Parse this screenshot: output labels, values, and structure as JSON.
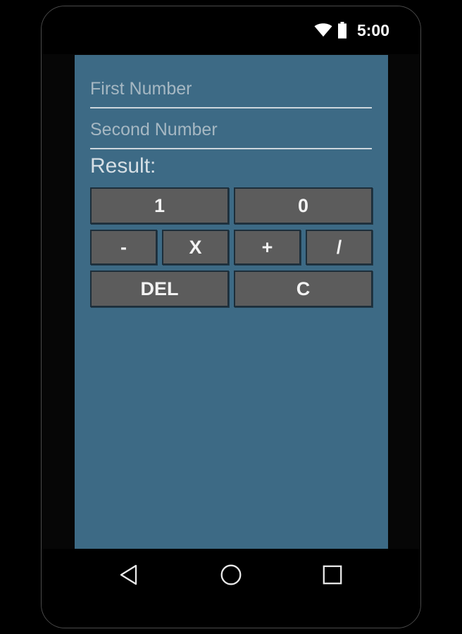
{
  "status_bar": {
    "clock": "5:00",
    "wifi_icon": "wifi-icon",
    "battery_icon": "battery-icon"
  },
  "app": {
    "background_color": "#3d6a85",
    "fields": [
      {
        "name": "first-number",
        "placeholder": "First Number",
        "value": ""
      },
      {
        "name": "second-number",
        "placeholder": "Second Number",
        "value": ""
      }
    ],
    "result_label": "Result:",
    "keypad": {
      "button_color": "#5c5c5c",
      "rows": [
        {
          "name": "digits",
          "buttons": [
            {
              "label": "1"
            },
            {
              "label": "0"
            }
          ]
        },
        {
          "name": "operators",
          "buttons": [
            {
              "label": "-"
            },
            {
              "label": "X"
            },
            {
              "label": "+"
            },
            {
              "label": "/"
            }
          ]
        },
        {
          "name": "edit",
          "buttons": [
            {
              "label": "DEL"
            },
            {
              "label": "C"
            }
          ]
        }
      ]
    }
  },
  "nav_bar": {
    "back_icon": "back-triangle-icon",
    "home_icon": "home-circle-icon",
    "recents_icon": "recents-square-icon"
  }
}
